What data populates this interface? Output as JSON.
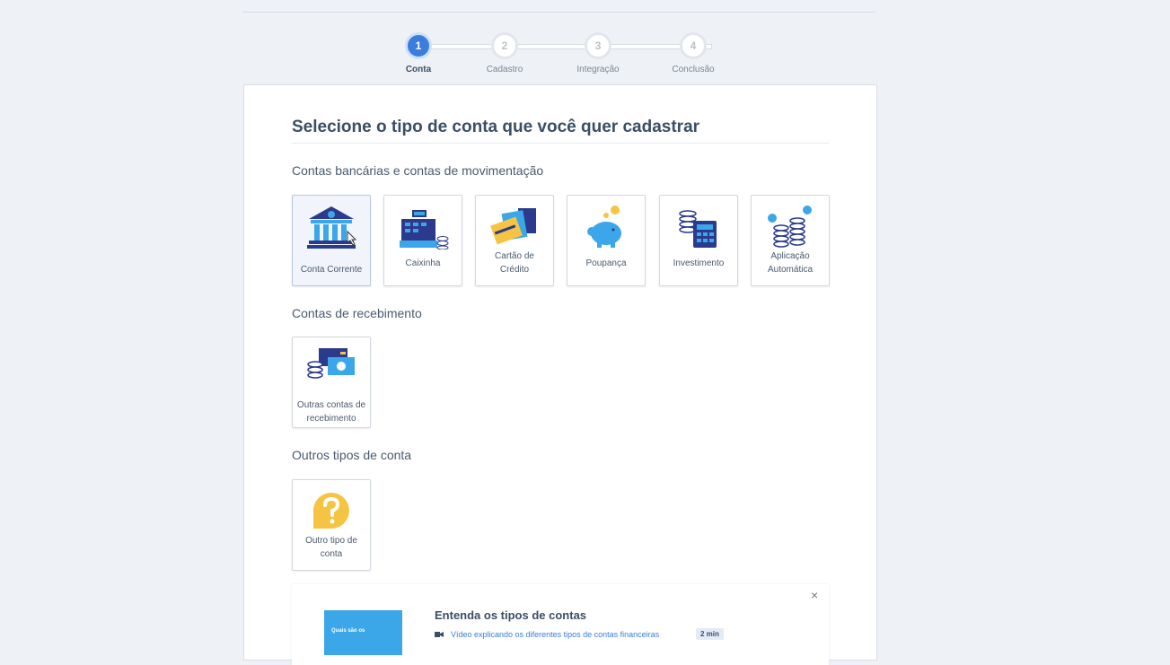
{
  "stepper": {
    "steps": [
      {
        "number": "1",
        "label": "Conta",
        "active": true
      },
      {
        "number": "2",
        "label": "Cadastro",
        "active": false
      },
      {
        "number": "3",
        "label": "Integração",
        "active": false
      },
      {
        "number": "4",
        "label": "Conclusão",
        "active": false
      }
    ]
  },
  "page": {
    "title": "Selecione o tipo de conta que você quer cadastrar"
  },
  "sections": {
    "banking": {
      "label": "Contas bancárias e contas de movimentação",
      "tiles": [
        {
          "label": "Conta Corrente",
          "icon": "bank-icon"
        },
        {
          "label": "Caixinha",
          "icon": "cash-register-icon"
        },
        {
          "label": "Cartão de Crédito",
          "icon": "credit-cards-icon"
        },
        {
          "label": "Poupança",
          "icon": "piggy-bank-icon"
        },
        {
          "label": "Investimento",
          "icon": "calculator-coins-icon"
        },
        {
          "label": "Aplicação Automática",
          "icon": "auto-coins-icon"
        }
      ]
    },
    "receiving": {
      "label": "Contas de recebimento",
      "tiles": [
        {
          "label": "Outras contas de recebimento",
          "icon": "receiving-card-icon"
        }
      ]
    },
    "other": {
      "label": "Outros tipos de conta",
      "tiles": [
        {
          "label": "Outro tipo de conta",
          "icon": "question-bubble-icon"
        }
      ]
    }
  },
  "info": {
    "title": "Entenda os tipos de contas",
    "link": "Vídeo explicando os diferentes tipos de contas financeiras",
    "duration": "2 min",
    "thumb_text": "Quais são os",
    "close": "×"
  },
  "colors": {
    "accent": "#3b7ddd",
    "icon_dark": "#2b3a8c",
    "icon_blue": "#3ba6e8",
    "icon_yellow": "#f5c443"
  }
}
